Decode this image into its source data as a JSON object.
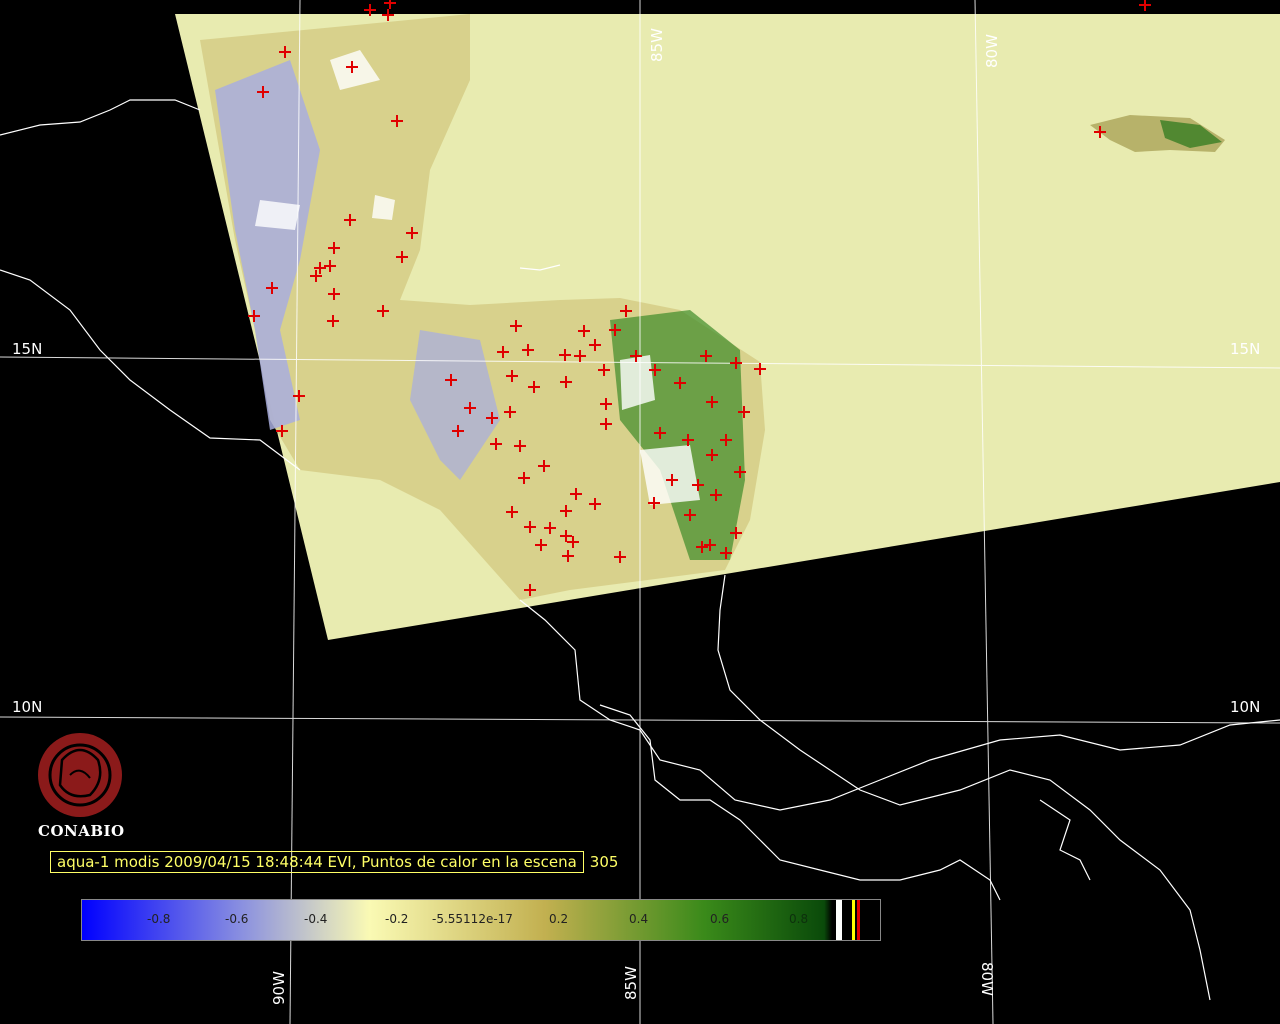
{
  "map": {
    "graticule_labels": {
      "lon_top": [
        "85W",
        "80W"
      ],
      "lon_bottom": [
        "90W",
        "85W",
        "80W"
      ],
      "lat_left": [
        "15N",
        "10N"
      ],
      "lat_right": [
        "15N",
        "10N"
      ]
    },
    "colors": {
      "background": "#000000",
      "coastline": "#ffffff",
      "graticule": "#ffffff",
      "no_data_fill": "#e8ebb0",
      "hotspot": "#e00000"
    }
  },
  "logo": {
    "text": "CONABIO",
    "icon": "conabio-logo-icon",
    "color": "#8b1a1a"
  },
  "caption": {
    "text": "aqua-1 modis 2009/04/15 18:48:44 EVI, Puntos de calor en la escena",
    "count": "305"
  },
  "colorbar": {
    "ticks": [
      "-0.8",
      "-0.6",
      "-0.4",
      "-0.2",
      "-5.55112e-17",
      "0.2",
      "0.4",
      "0.6",
      "0.8"
    ],
    "colors": [
      "#0000ff",
      "#8a90e0",
      "#fafab4",
      "#c2b050",
      "#3a8a1a",
      "#0a4a0a"
    ]
  }
}
